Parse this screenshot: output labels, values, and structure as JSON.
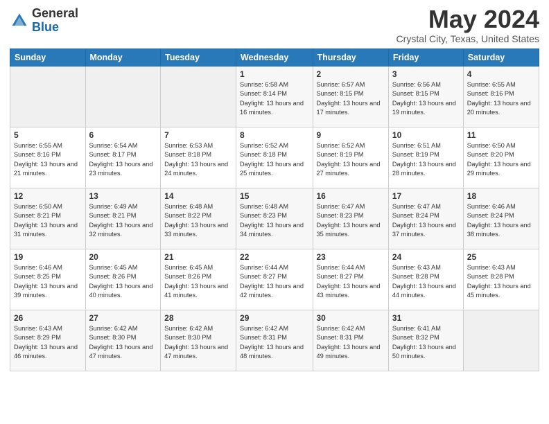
{
  "header": {
    "logo_general": "General",
    "logo_blue": "Blue",
    "title": "May 2024",
    "location": "Crystal City, Texas, United States"
  },
  "days_of_week": [
    "Sunday",
    "Monday",
    "Tuesday",
    "Wednesday",
    "Thursday",
    "Friday",
    "Saturday"
  ],
  "weeks": [
    [
      {
        "day": "",
        "info": ""
      },
      {
        "day": "",
        "info": ""
      },
      {
        "day": "",
        "info": ""
      },
      {
        "day": "1",
        "info": "Sunrise: 6:58 AM\nSunset: 8:14 PM\nDaylight: 13 hours\nand 16 minutes."
      },
      {
        "day": "2",
        "info": "Sunrise: 6:57 AM\nSunset: 8:15 PM\nDaylight: 13 hours\nand 17 minutes."
      },
      {
        "day": "3",
        "info": "Sunrise: 6:56 AM\nSunset: 8:15 PM\nDaylight: 13 hours\nand 19 minutes."
      },
      {
        "day": "4",
        "info": "Sunrise: 6:55 AM\nSunset: 8:16 PM\nDaylight: 13 hours\nand 20 minutes."
      }
    ],
    [
      {
        "day": "5",
        "info": "Sunrise: 6:55 AM\nSunset: 8:16 PM\nDaylight: 13 hours\nand 21 minutes."
      },
      {
        "day": "6",
        "info": "Sunrise: 6:54 AM\nSunset: 8:17 PM\nDaylight: 13 hours\nand 23 minutes."
      },
      {
        "day": "7",
        "info": "Sunrise: 6:53 AM\nSunset: 8:18 PM\nDaylight: 13 hours\nand 24 minutes."
      },
      {
        "day": "8",
        "info": "Sunrise: 6:52 AM\nSunset: 8:18 PM\nDaylight: 13 hours\nand 25 minutes."
      },
      {
        "day": "9",
        "info": "Sunrise: 6:52 AM\nSunset: 8:19 PM\nDaylight: 13 hours\nand 27 minutes."
      },
      {
        "day": "10",
        "info": "Sunrise: 6:51 AM\nSunset: 8:19 PM\nDaylight: 13 hours\nand 28 minutes."
      },
      {
        "day": "11",
        "info": "Sunrise: 6:50 AM\nSunset: 8:20 PM\nDaylight: 13 hours\nand 29 minutes."
      }
    ],
    [
      {
        "day": "12",
        "info": "Sunrise: 6:50 AM\nSunset: 8:21 PM\nDaylight: 13 hours\nand 31 minutes."
      },
      {
        "day": "13",
        "info": "Sunrise: 6:49 AM\nSunset: 8:21 PM\nDaylight: 13 hours\nand 32 minutes."
      },
      {
        "day": "14",
        "info": "Sunrise: 6:48 AM\nSunset: 8:22 PM\nDaylight: 13 hours\nand 33 minutes."
      },
      {
        "day": "15",
        "info": "Sunrise: 6:48 AM\nSunset: 8:23 PM\nDaylight: 13 hours\nand 34 minutes."
      },
      {
        "day": "16",
        "info": "Sunrise: 6:47 AM\nSunset: 8:23 PM\nDaylight: 13 hours\nand 35 minutes."
      },
      {
        "day": "17",
        "info": "Sunrise: 6:47 AM\nSunset: 8:24 PM\nDaylight: 13 hours\nand 37 minutes."
      },
      {
        "day": "18",
        "info": "Sunrise: 6:46 AM\nSunset: 8:24 PM\nDaylight: 13 hours\nand 38 minutes."
      }
    ],
    [
      {
        "day": "19",
        "info": "Sunrise: 6:46 AM\nSunset: 8:25 PM\nDaylight: 13 hours\nand 39 minutes."
      },
      {
        "day": "20",
        "info": "Sunrise: 6:45 AM\nSunset: 8:26 PM\nDaylight: 13 hours\nand 40 minutes."
      },
      {
        "day": "21",
        "info": "Sunrise: 6:45 AM\nSunset: 8:26 PM\nDaylight: 13 hours\nand 41 minutes."
      },
      {
        "day": "22",
        "info": "Sunrise: 6:44 AM\nSunset: 8:27 PM\nDaylight: 13 hours\nand 42 minutes."
      },
      {
        "day": "23",
        "info": "Sunrise: 6:44 AM\nSunset: 8:27 PM\nDaylight: 13 hours\nand 43 minutes."
      },
      {
        "day": "24",
        "info": "Sunrise: 6:43 AM\nSunset: 8:28 PM\nDaylight: 13 hours\nand 44 minutes."
      },
      {
        "day": "25",
        "info": "Sunrise: 6:43 AM\nSunset: 8:28 PM\nDaylight: 13 hours\nand 45 minutes."
      }
    ],
    [
      {
        "day": "26",
        "info": "Sunrise: 6:43 AM\nSunset: 8:29 PM\nDaylight: 13 hours\nand 46 minutes."
      },
      {
        "day": "27",
        "info": "Sunrise: 6:42 AM\nSunset: 8:30 PM\nDaylight: 13 hours\nand 47 minutes."
      },
      {
        "day": "28",
        "info": "Sunrise: 6:42 AM\nSunset: 8:30 PM\nDaylight: 13 hours\nand 47 minutes."
      },
      {
        "day": "29",
        "info": "Sunrise: 6:42 AM\nSunset: 8:31 PM\nDaylight: 13 hours\nand 48 minutes."
      },
      {
        "day": "30",
        "info": "Sunrise: 6:42 AM\nSunset: 8:31 PM\nDaylight: 13 hours\nand 49 minutes."
      },
      {
        "day": "31",
        "info": "Sunrise: 6:41 AM\nSunset: 8:32 PM\nDaylight: 13 hours\nand 50 minutes."
      },
      {
        "day": "",
        "info": ""
      }
    ]
  ]
}
